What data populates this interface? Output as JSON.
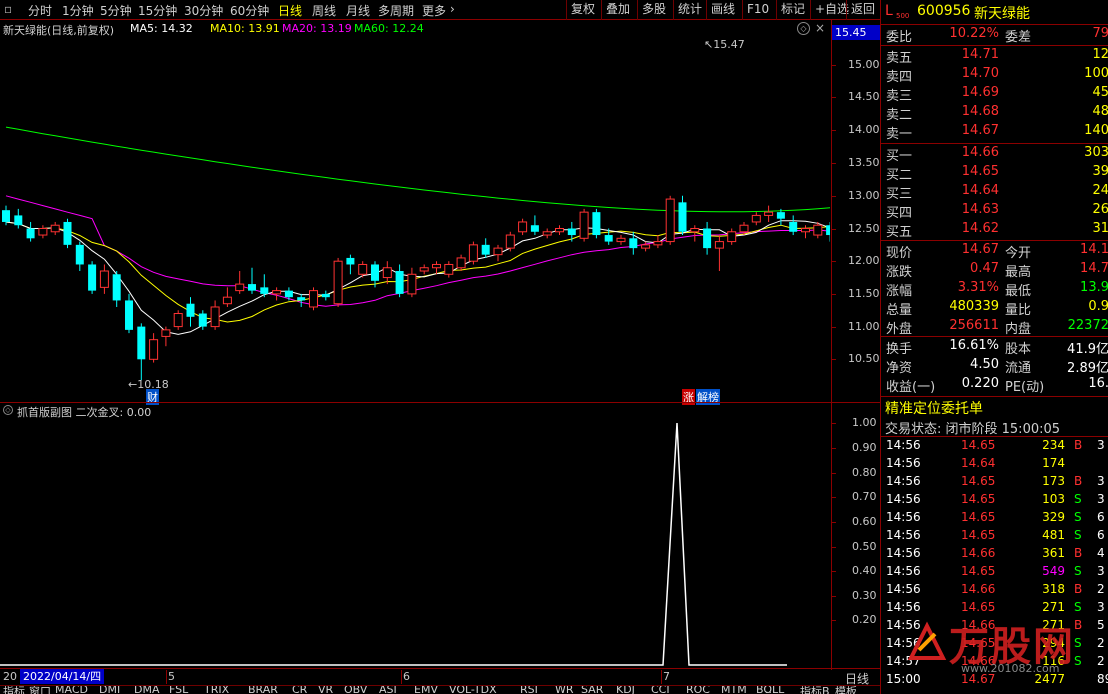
{
  "toolbar": {
    "left": [
      "分时",
      "1分钟",
      "5分钟",
      "15分钟",
      "30分钟",
      "60分钟",
      "日线",
      "周线",
      "月线",
      "多周期",
      "更多"
    ],
    "active": "日线",
    "right": [
      "复权",
      "叠加",
      "多股",
      "统计",
      "画线",
      "F10",
      "标记",
      "+自选",
      "返回"
    ]
  },
  "header": {
    "title": "新天绿能(日线,前复权)",
    "ma": [
      {
        "label": "MA5: 14.32",
        "color": "#ffffff"
      },
      {
        "label": "MA10: 13.91",
        "color": "#ffff00"
      },
      {
        "label": "MA20: 13.19",
        "color": "#ff00ff"
      },
      {
        "label": "MA60: 12.24",
        "color": "#00ff00"
      }
    ],
    "price_badge": "15.45"
  },
  "price_axis": [
    "15.00",
    "14.50",
    "14.00",
    "13.50",
    "13.00",
    "12.50",
    "12.00",
    "11.50",
    "11.00",
    "10.50"
  ],
  "annotations": {
    "high": "15.47",
    "low": "10.18",
    "cai": "财",
    "zhang": "涨",
    "jiebang": "解榜"
  },
  "sub": {
    "title": "抓首版副图  二次金叉: 0.00",
    "axis": [
      "1.00",
      "0.90",
      "0.80",
      "0.70",
      "0.60",
      "0.50",
      "0.40",
      "0.30",
      "0.20"
    ]
  },
  "xaxis": {
    "start": "20",
    "date": "2022/04/14/四",
    "months": [
      "5",
      "6",
      "7"
    ],
    "period": "日线"
  },
  "bottom_tabs": [
    "指标",
    "窗口",
    "MACD",
    "DMI",
    "DMA",
    "FSL",
    "TRIX",
    "BRAR",
    "CR",
    "VR",
    "OBV",
    "ASI",
    "EMV",
    "VOL-TDX",
    "RSI",
    "WR",
    "SAR",
    "KDJ",
    "CCI",
    "ROC",
    "MTM",
    "BOLL",
    "...",
    "指标B",
    "模板"
  ],
  "quote": {
    "level": "L",
    "level_sub": "500",
    "code": "600956",
    "name": "新天绿能",
    "weibi_label": "委比",
    "weibi": "10.22%",
    "weicha_label": "委差",
    "weicha": "79",
    "sells": [
      {
        "label": "卖五",
        "price": "14.71",
        "vol": "12"
      },
      {
        "label": "卖四",
        "price": "14.70",
        "vol": "100"
      },
      {
        "label": "卖三",
        "price": "14.69",
        "vol": "45"
      },
      {
        "label": "卖二",
        "price": "14.68",
        "vol": "48"
      },
      {
        "label": "卖一",
        "price": "14.67",
        "vol": "140"
      }
    ],
    "buys": [
      {
        "label": "买一",
        "price": "14.66",
        "vol": "303"
      },
      {
        "label": "买二",
        "price": "14.65",
        "vol": "39"
      },
      {
        "label": "买三",
        "price": "14.64",
        "vol": "24"
      },
      {
        "label": "买四",
        "price": "14.63",
        "vol": "26"
      },
      {
        "label": "买五",
        "price": "14.62",
        "vol": "31"
      }
    ],
    "stats": [
      {
        "l1": "现价",
        "v1": "14.67",
        "c1": "r",
        "l2": "今开",
        "v2": "14.1",
        "c2": "r"
      },
      {
        "l1": "涨跌",
        "v1": "0.47",
        "c1": "r",
        "l2": "最高",
        "v2": "14.7",
        "c2": "r"
      },
      {
        "l1": "涨幅",
        "v1": "3.31%",
        "c1": "r",
        "l2": "最低",
        "v2": "13.9",
        "c2": "g"
      },
      {
        "l1": "总量",
        "v1": "480339",
        "c1": "y",
        "l2": "量比",
        "v2": "0.9",
        "c2": "y"
      },
      {
        "l1": "外盘",
        "v1": "256611",
        "c1": "r",
        "l2": "内盘",
        "v2": "22372",
        "c2": "g"
      }
    ],
    "stats2": [
      {
        "l1": "换手",
        "v1": "16.61%",
        "l2": "股本",
        "v2": "41.9亿"
      },
      {
        "l1": "净资",
        "v1": "4.50",
        "l2": "流通",
        "v2": "2.89亿"
      },
      {
        "l1": "收益(一)",
        "v1": "0.220",
        "l2": "PE(动)",
        "v2": "16."
      }
    ],
    "jingzhun": "精准定位委托单",
    "status": "交易状态: 闭市阶段 15:00:05",
    "ticks": [
      {
        "t": "14:56",
        "p": "14.65",
        "v": "234",
        "s": "B",
        "n": "3"
      },
      {
        "t": "14:56",
        "p": "14.64",
        "v": "174",
        "s": "",
        "n": ""
      },
      {
        "t": "14:56",
        "p": "14.65",
        "v": "173",
        "s": "B",
        "n": "3"
      },
      {
        "t": "14:56",
        "p": "14.65",
        "v": "103",
        "s": "S",
        "n": "3"
      },
      {
        "t": "14:56",
        "p": "14.65",
        "v": "329",
        "s": "S",
        "n": "6"
      },
      {
        "t": "14:56",
        "p": "14.65",
        "v": "481",
        "s": "S",
        "n": "6"
      },
      {
        "t": "14:56",
        "p": "14.66",
        "v": "361",
        "s": "B",
        "n": "4"
      },
      {
        "t": "14:56",
        "p": "14.65",
        "v": "549",
        "s": "S",
        "n": "3"
      },
      {
        "t": "14:56",
        "p": "14.66",
        "v": "318",
        "s": "B",
        "n": "2"
      },
      {
        "t": "14:56",
        "p": "14.65",
        "v": "271",
        "s": "S",
        "n": "3"
      },
      {
        "t": "14:56",
        "p": "14.66",
        "v": "271",
        "s": "B",
        "n": "5"
      },
      {
        "t": "14:56",
        "p": "14.65",
        "v": "294",
        "s": "S",
        "n": "2"
      },
      {
        "t": "14:57",
        "p": "14.66",
        "v": "116",
        "s": "S",
        "n": "2"
      },
      {
        "t": "15:00",
        "p": "14.67",
        "v": "2477",
        "s": "",
        "n": "89"
      }
    ],
    "watermark": "万股网",
    "watermark_url": "www.201082.com"
  }
}
